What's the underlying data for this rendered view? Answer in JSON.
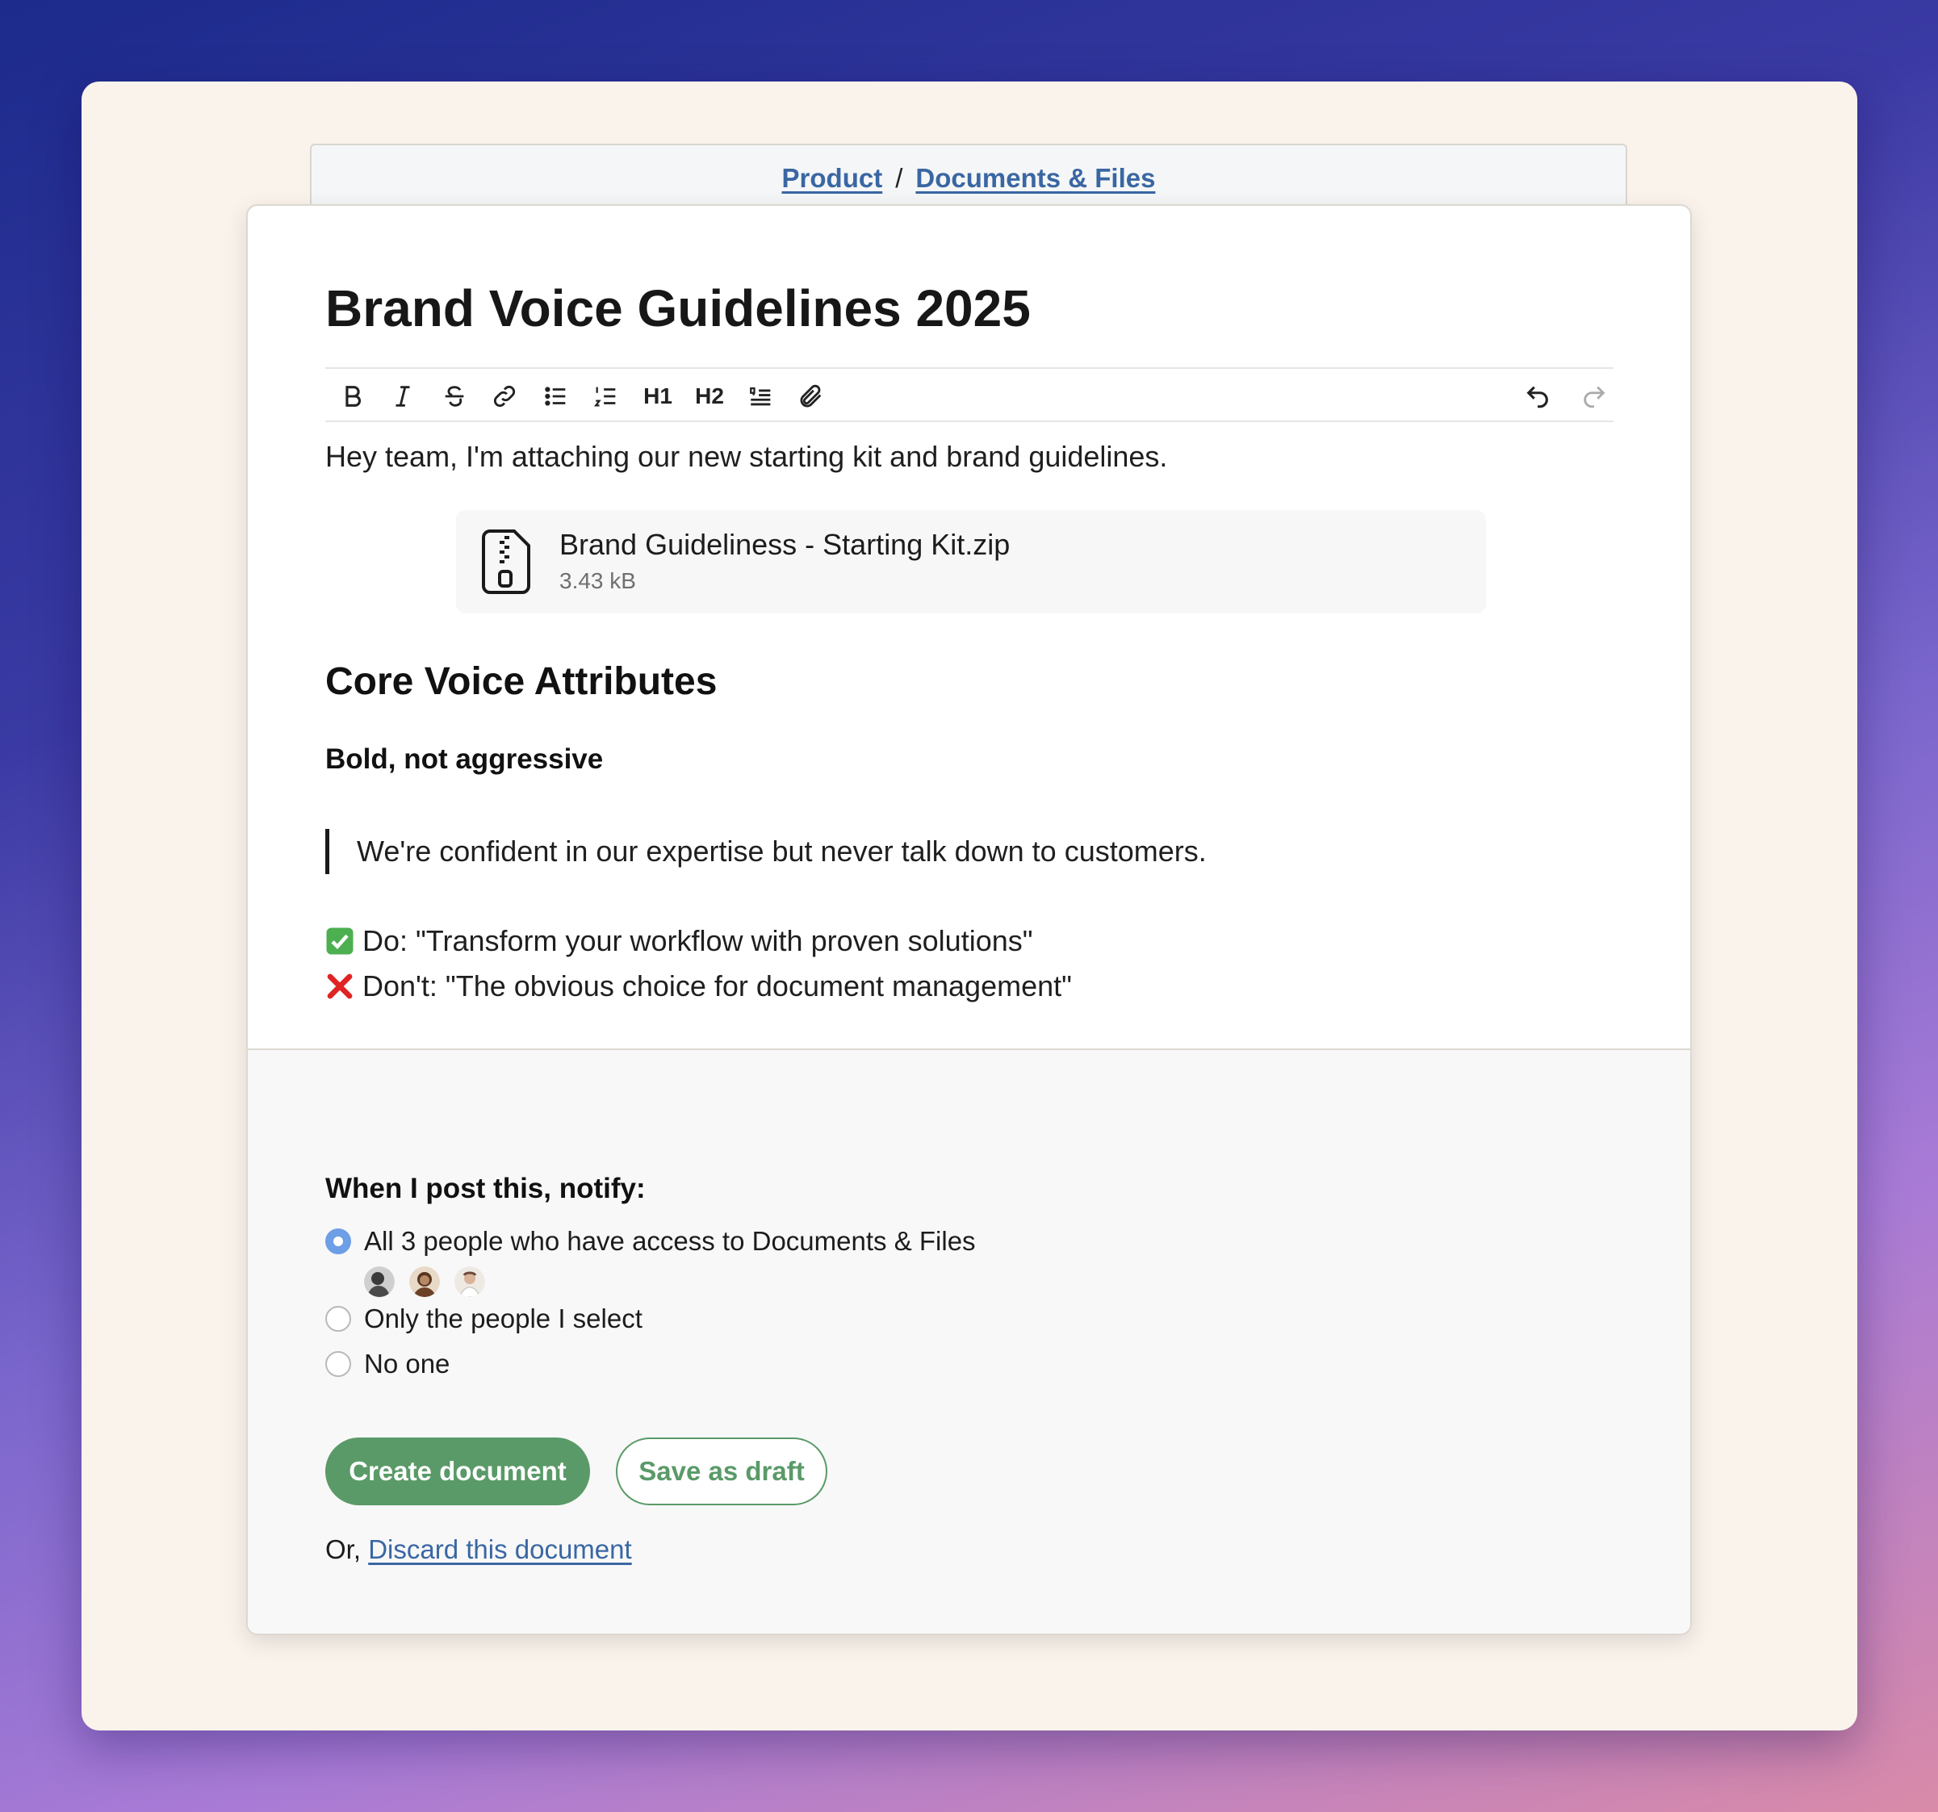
{
  "breadcrumb": {
    "items": [
      {
        "label": "Product"
      },
      {
        "label": "Documents & Files"
      }
    ],
    "separator": "/"
  },
  "document": {
    "title": "Brand Voice Guidelines 2025",
    "intro": "Hey team, I'm attaching our new starting kit and brand guidelines.",
    "attachment": {
      "icon": "zip-file-icon",
      "name": "Brand Guideliness - Starting Kit.zip",
      "size": "3.43 kB"
    },
    "section_heading": "Core Voice Attributes",
    "subheading": "Bold, not aggressive",
    "quote": "We're confident in our expertise but never talk down to customers.",
    "do_line": "Do: \"Transform your workflow with proven solutions\"",
    "dont_line": "Don't: \"The obvious choice for document management\""
  },
  "toolbar": {
    "buttons": [
      "bold-icon",
      "italic-icon",
      "strikethrough-icon",
      "link-icon",
      "bullet-list-icon",
      "numbered-list-icon",
      "heading1-icon",
      "heading2-icon",
      "quote-icon",
      "attachment-icon"
    ],
    "heading1": "H1",
    "heading2": "H2",
    "undo": "undo-icon",
    "redo": "redo-icon"
  },
  "notify": {
    "label": "When I post this, notify:",
    "options": [
      {
        "label": "All 3 people who have access to Documents & Files",
        "selected": true
      },
      {
        "label": "Only the people I select",
        "selected": false
      },
      {
        "label": "No one",
        "selected": false
      }
    ]
  },
  "actions": {
    "create": "Create document",
    "draft": "Save as draft",
    "discard_prefix": "Or,",
    "discard_link": "Discard this document"
  },
  "colors": {
    "accent_green": "#5a9a68",
    "link_blue": "#3a67a3",
    "radio_blue": "#6d9ee6"
  }
}
